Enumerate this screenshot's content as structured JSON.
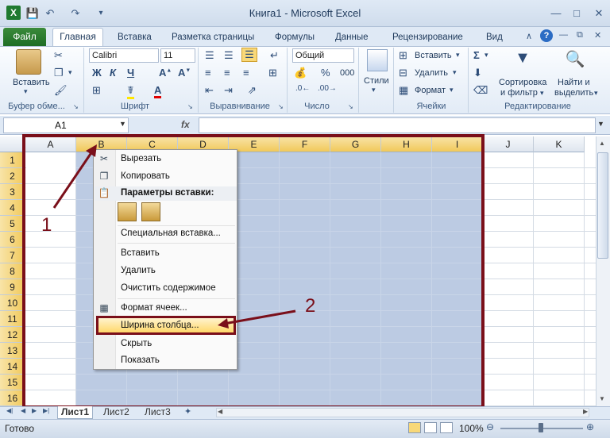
{
  "window": {
    "title": "Книга1 - Microsoft Excel"
  },
  "tabs": {
    "file": "Файл",
    "home": "Главная",
    "insert": "Вставка",
    "page_layout": "Разметка страницы",
    "formulas": "Формулы",
    "data": "Данные",
    "review": "Рецензирование",
    "view": "Вид"
  },
  "ribbon": {
    "paste": "Вставить",
    "clipboard_label": "Буфер обме...",
    "font_name": "Calibri",
    "font_size": "11",
    "font_label": "Шрифт",
    "bold": "Ж",
    "italic": "К",
    "underline": "Ч",
    "alignment_label": "Выравнивание",
    "number_format": "Общий",
    "number_label": "Число",
    "percent": "%",
    "thousands": "000",
    "styles": "Стили",
    "insert_cells": "Вставить",
    "delete_cells": "Удалить",
    "format_cells": "Формат",
    "cells_label": "Ячейки",
    "sigma": "Σ",
    "sort_filter_1": "Сортировка",
    "sort_filter_2": "и фильтр",
    "find_select_1": "Найти и",
    "find_select_2": "выделить",
    "editing_label": "Редактирование"
  },
  "formula_bar": {
    "name_box": "A1",
    "fx": "fx",
    "value": ""
  },
  "columns": [
    "A",
    "B",
    "C",
    "D",
    "E",
    "F",
    "G",
    "H",
    "I",
    "J",
    "K"
  ],
  "rows": [
    "1",
    "2",
    "3",
    "4",
    "5",
    "6",
    "7",
    "8",
    "9",
    "10",
    "11",
    "12",
    "13",
    "14",
    "15",
    "16"
  ],
  "context_menu": {
    "cut": "Вырезать",
    "copy": "Копировать",
    "paste_options": "Параметры вставки:",
    "paste_special": "Специальная вставка...",
    "insert": "Вставить",
    "delete": "Удалить",
    "clear": "Очистить содержимое",
    "format_cells": "Формат ячеек...",
    "column_width": "Ширина столбца...",
    "hide": "Скрыть",
    "unhide": "Показать"
  },
  "annotations": {
    "step1": "1",
    "step2": "2"
  },
  "sheets": [
    "Лист1",
    "Лист2",
    "Лист3"
  ],
  "status": {
    "ready": "Готово",
    "zoom": "100%"
  },
  "colors": {
    "accent_red": "#7a0f1a",
    "selection": "#b8c8e2",
    "file_tab": "#1f6e26"
  }
}
